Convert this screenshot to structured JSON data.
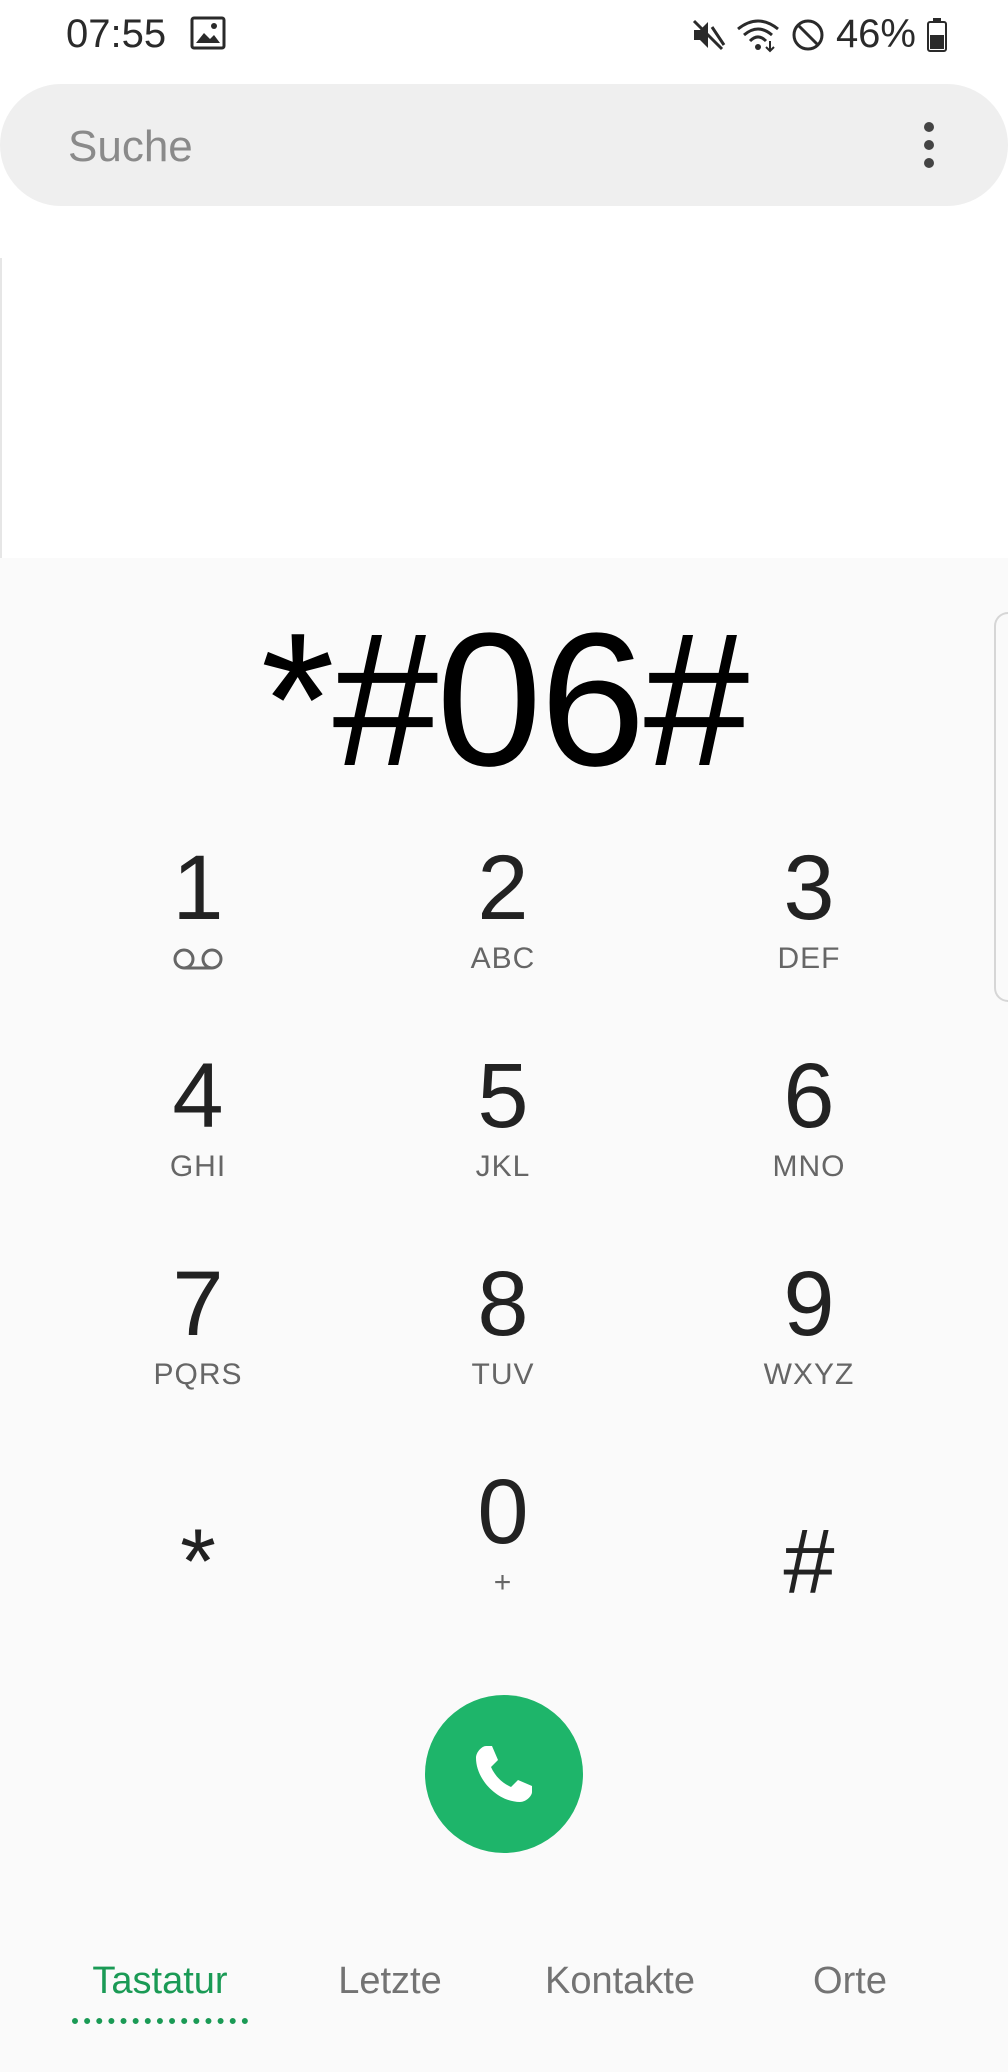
{
  "status_bar": {
    "time": "07:55",
    "battery": "46%",
    "icons": [
      "gallery-icon",
      "mute-icon",
      "wifi-icon",
      "do-not-disturb-icon",
      "battery-icon"
    ]
  },
  "search": {
    "placeholder": "Suche"
  },
  "dialer": {
    "number": "*#06#",
    "keys": [
      {
        "digit": "1",
        "letters": ""
      },
      {
        "digit": "2",
        "letters": "ABC"
      },
      {
        "digit": "3",
        "letters": "DEF"
      },
      {
        "digit": "4",
        "letters": "GHI"
      },
      {
        "digit": "5",
        "letters": "JKL"
      },
      {
        "digit": "6",
        "letters": "MNO"
      },
      {
        "digit": "7",
        "letters": "PQRS"
      },
      {
        "digit": "8",
        "letters": "TUV"
      },
      {
        "digit": "9",
        "letters": "WXYZ"
      },
      {
        "digit": "*",
        "letters": ""
      },
      {
        "digit": "0",
        "letters": "+"
      },
      {
        "digit": "#",
        "letters": ""
      }
    ],
    "call_color": "#1eb56a"
  },
  "tabs": [
    {
      "label": "Tastatur",
      "active": true
    },
    {
      "label": "Letzte",
      "active": false
    },
    {
      "label": "Kontakte",
      "active": false
    },
    {
      "label": "Orte",
      "active": false
    }
  ],
  "accent_color": "#1a9a55"
}
